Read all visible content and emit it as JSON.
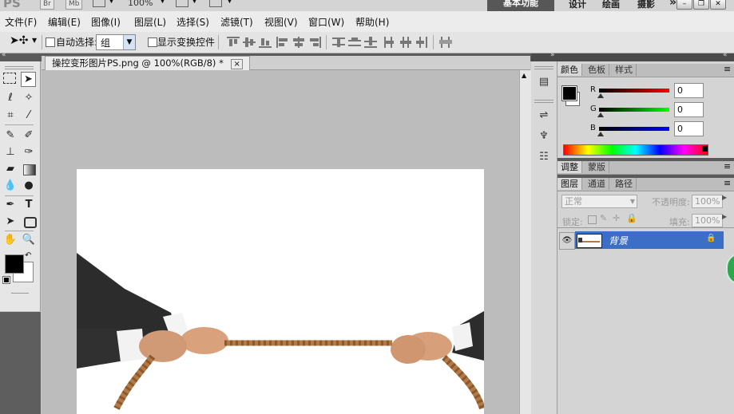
{
  "app": {
    "logo": "PS",
    "mini_buttons": [
      "Br",
      "Mb"
    ],
    "zoom": "100%",
    "workspaces": [
      "基本功能",
      "设计",
      "绘画",
      "摄影"
    ],
    "more": "»"
  },
  "menu": {
    "items": [
      "文件(F)",
      "编辑(E)",
      "图像(I)",
      "图层(L)",
      "选择(S)",
      "滤镜(T)",
      "视图(V)",
      "窗口(W)",
      "帮助(H)"
    ]
  },
  "options": {
    "auto_select_label": "自动选择:",
    "auto_select_value": "组",
    "show_transform_label": "显示变换控件"
  },
  "document": {
    "tab_title": "操控变形图片PS.png @ 100%(RGB/8) *",
    "close": "×"
  },
  "color_panel": {
    "tabs": [
      "颜色",
      "色板",
      "样式"
    ],
    "channels": [
      {
        "label": "R",
        "value": "0",
        "color": "#d00000"
      },
      {
        "label": "G",
        "value": "0",
        "color": "#00b000"
      },
      {
        "label": "B",
        "value": "0",
        "color": "#0000cc"
      }
    ]
  },
  "adjust_panel": {
    "tabs": [
      "调整",
      "蒙版"
    ]
  },
  "layers_panel": {
    "tabs": [
      "图层",
      "通道",
      "路径"
    ],
    "blend_mode": "正常",
    "opacity_label": "不透明度:",
    "opacity_value": "100%",
    "lock_label": "锁定:",
    "fill_label": "填充:",
    "fill_value": "100%",
    "layer_name": "背景"
  },
  "colors": {
    "accent_workspace": "#575757",
    "layer_selected": "#3a6ec7",
    "foreground": "#000000",
    "background": "#ffffff",
    "rope": "#b47a45"
  }
}
